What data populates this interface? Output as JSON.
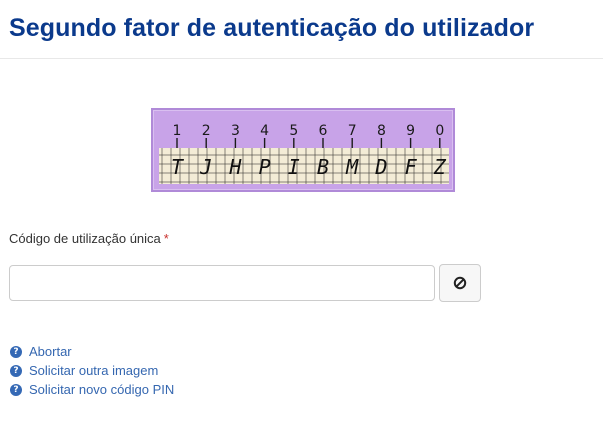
{
  "header": {
    "title": "Segundo fator de autenticação do utilizador"
  },
  "grid": {
    "numbers": [
      "1",
      "2",
      "3",
      "4",
      "5",
      "6",
      "7",
      "8",
      "9",
      "0"
    ],
    "letters": [
      "T",
      "J",
      "H",
      "P",
      "I",
      "B",
      "M",
      "D",
      "F",
      "Z"
    ],
    "colors": {
      "background": "#c8a3e8",
      "strip": "#f3ecd6"
    }
  },
  "form": {
    "otp_label": "Código de utilização única",
    "required_marker": "*",
    "otp_value": "",
    "clear_icon": "cancel-icon"
  },
  "links": [
    {
      "label": "Abortar",
      "icon": "help-circle-icon"
    },
    {
      "label": "Solicitar outra imagem",
      "icon": "help-circle-icon"
    },
    {
      "label": "Solicitar novo código PIN",
      "icon": "help-circle-icon"
    }
  ]
}
